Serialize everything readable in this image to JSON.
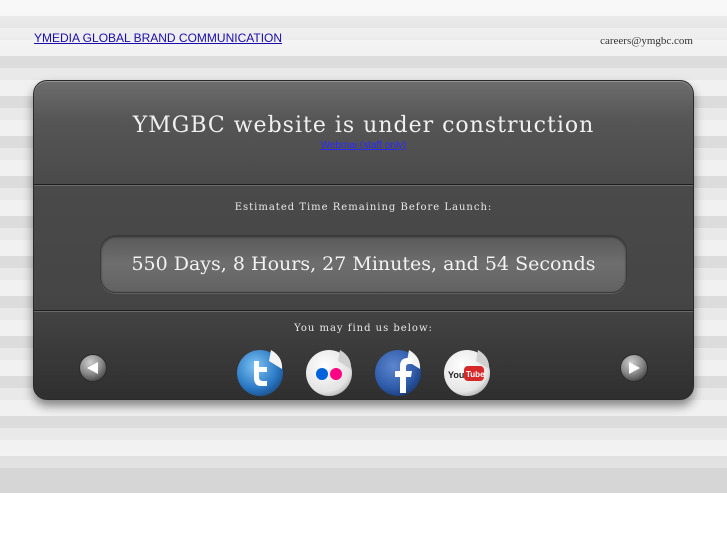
{
  "header": {
    "company_link": "YMEDIA GLOBAL BRAND COMMUNICATION",
    "email": "careers@ymgbc.com"
  },
  "panel": {
    "title": "YMGBC website is under construction",
    "webmail_link": "Webmai (staff only)",
    "estimate_label": "Estimated Time Remaining Before Launch:",
    "countdown": "550 Days, 8 Hours, 27 Minutes, and 54 Seconds",
    "find_label": "You may find us below:"
  },
  "social": [
    {
      "name": "twitter",
      "icon": "twitter-icon",
      "color": "#2b78c5"
    },
    {
      "name": "flickr",
      "icon": "flickr-icon",
      "colors": [
        "#0063dc",
        "#ff0084"
      ]
    },
    {
      "name": "facebook",
      "icon": "facebook-icon",
      "color": "#2d5aa8"
    },
    {
      "name": "youtube",
      "icon": "youtube-icon",
      "color": "#d62828"
    }
  ],
  "nav": {
    "prev_icon": "arrow-left-icon",
    "next_icon": "arrow-right-icon"
  },
  "colors": {
    "panel_bg": "#4a4a4a",
    "link": "#1a0dab"
  }
}
